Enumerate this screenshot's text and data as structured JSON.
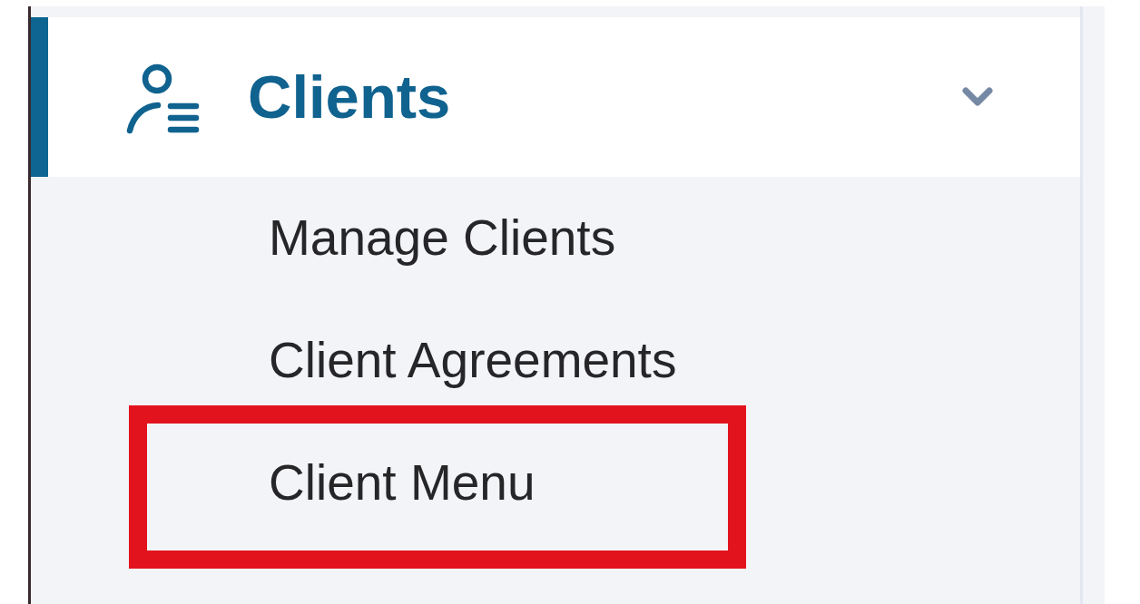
{
  "sidebar": {
    "sections": [
      {
        "label": "Clients",
        "selected": true,
        "expanded": true,
        "items": [
          {
            "label": "Manage Clients",
            "highlighted": false
          },
          {
            "label": "Client Agreements",
            "highlighted": false
          },
          {
            "label": "Client Menu",
            "highlighted": true
          }
        ]
      }
    ]
  }
}
